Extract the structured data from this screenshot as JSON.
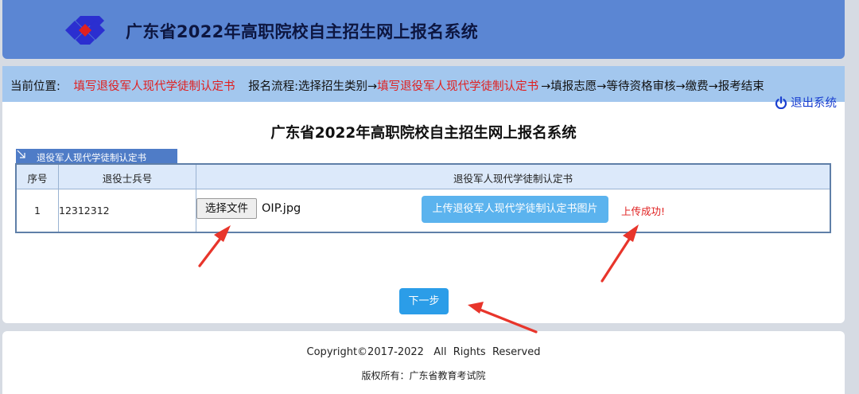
{
  "header": {
    "title": "广东省2022年高职院校自主招生网上报名系统"
  },
  "location": {
    "label": "当前位置:",
    "current": "填写退役军人现代学徒制认定书",
    "flow_prefix": "报名流程:选择招生类别→",
    "flow_current": "填写退役军人现代学徒制认定书",
    "flow_suffix": "→填报志愿→等待资格审核→缴费→报考结束"
  },
  "logout": {
    "label": "退出系统",
    "icon": "power-icon"
  },
  "page_title": "广东省2022年高职院校自主招生网上报名系统",
  "section": {
    "tab_label": "退役军人现代学徒制认定书"
  },
  "table": {
    "headers": [
      "序号",
      "退役士兵号",
      "退役军人现代学徒制认定书"
    ],
    "rows": [
      {
        "index": "1",
        "soldier_no": "12312312",
        "file_button": "选择文件",
        "file_name": "OIP.jpg",
        "upload_button": "上传退役军人现代学徒制认定书图片",
        "status": "上传成功!"
      }
    ]
  },
  "next_button": "下一步",
  "footer": {
    "copyright": "Copyright©2017-2022   All  Rights  Reserved",
    "owner": "版权所有：广东省教育考试院"
  },
  "colors": {
    "header_bg": "#5b86d3",
    "location_bar": "#a3c7ee",
    "accent_red": "#e02020",
    "primary_button": "#2b9de8",
    "annotation_arrow": "#e8352b"
  }
}
